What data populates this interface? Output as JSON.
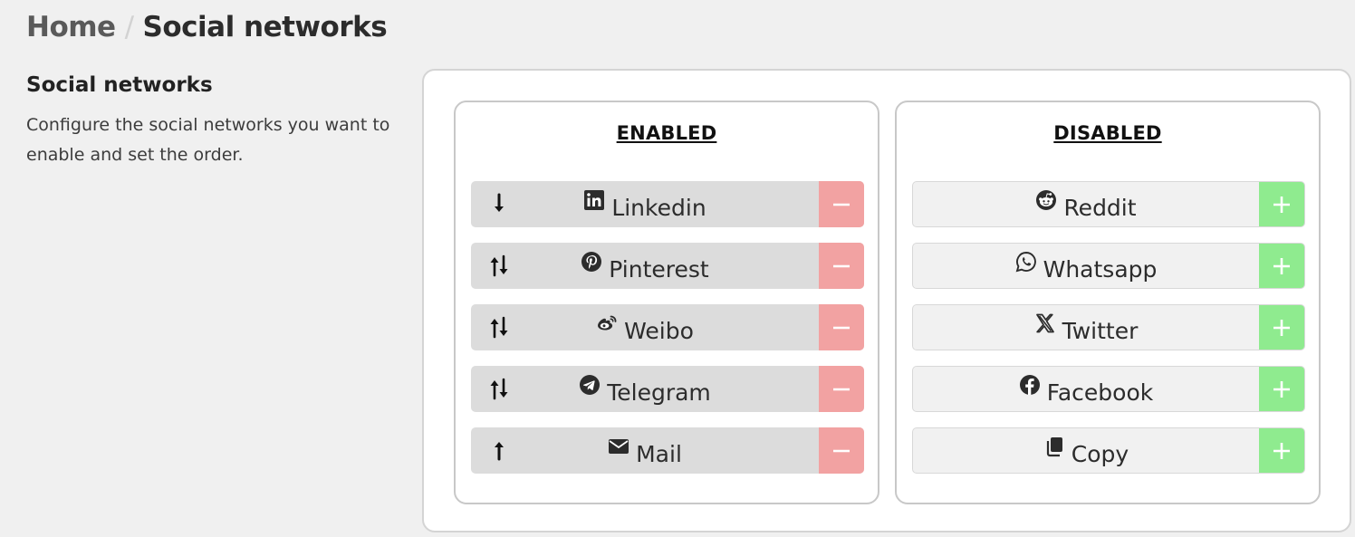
{
  "breadcrumb": {
    "home": "Home",
    "separator": "/",
    "current": "Social networks"
  },
  "section": {
    "title": "Social networks",
    "description": "Configure the social networks you want to enable and set the order."
  },
  "panels": {
    "enabled": {
      "heading": "ENABLED",
      "action": "remove",
      "action_color": "#f2a2a2",
      "items": [
        {
          "label": "Linkedin",
          "icon": "linkedin-icon",
          "sort": "down"
        },
        {
          "label": "Pinterest",
          "icon": "pinterest-icon",
          "sort": "up-down"
        },
        {
          "label": "Weibo",
          "icon": "weibo-icon",
          "sort": "up-down"
        },
        {
          "label": "Telegram",
          "icon": "telegram-icon",
          "sort": "up-down"
        },
        {
          "label": "Mail",
          "icon": "mail-icon",
          "sort": "up"
        }
      ]
    },
    "disabled": {
      "heading": "DISABLED",
      "action": "add",
      "action_color": "#8feb8f",
      "items": [
        {
          "label": "Reddit",
          "icon": "reddit-icon"
        },
        {
          "label": "Whatsapp",
          "icon": "whatsapp-icon"
        },
        {
          "label": "Twitter",
          "icon": "x-twitter-icon"
        },
        {
          "label": "Facebook",
          "icon": "facebook-icon"
        },
        {
          "label": "Copy",
          "icon": "copy-icon"
        }
      ]
    }
  }
}
